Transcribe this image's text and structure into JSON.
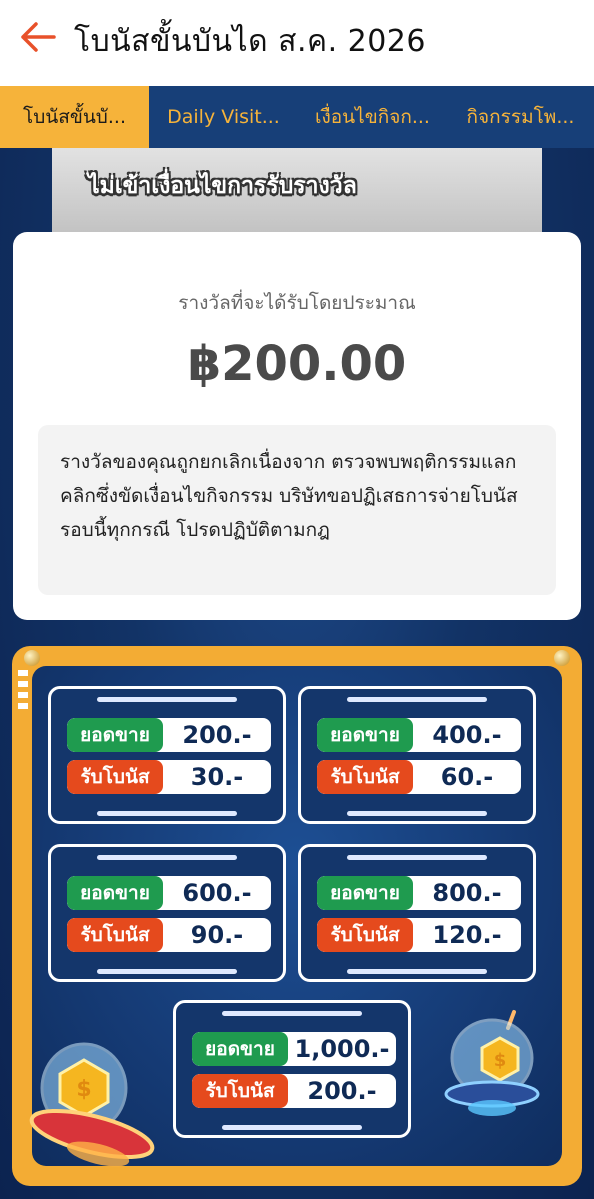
{
  "header": {
    "title": "โบนัสขั้นบันได ส.ค. 2026"
  },
  "tabs": [
    {
      "label": "โบนัสขั้นบั...",
      "active": true
    },
    {
      "label": "Daily Visit...",
      "active": false
    },
    {
      "label": "เงื่อนไขกิจก...",
      "active": false
    },
    {
      "label": "กิจกรรมโพ...",
      "active": false
    }
  ],
  "banner": {
    "text": "ไม่เข้าเงื่อนไขการรับรางวัล"
  },
  "card": {
    "label": "รางวัลที่จะได้รับโดยประมาณ",
    "amount": "฿200.00",
    "notice": "รางวัลของคุณถูกยกเลิกเนื่องจาก ตรวจพบพฤติกรรมแลกคลิกซึ่งขัดเงื่อนไขกิจกรรม บริษัทขอปฏิเสธการจ่ายโบนัสรอบนี้ทุกกรณี โปรดปฏิบัติตามกฎ"
  },
  "tiers": [
    {
      "sales_label": "ยอดขาย",
      "sales": "200.-",
      "bonus_label": "รับโบนัส",
      "bonus": "30.-"
    },
    {
      "sales_label": "ยอดขาย",
      "sales": "400.-",
      "bonus_label": "รับโบนัส",
      "bonus": "60.-"
    },
    {
      "sales_label": "ยอดขาย",
      "sales": "600.-",
      "bonus_label": "รับโบนัส",
      "bonus": "90.-"
    },
    {
      "sales_label": "ยอดขาย",
      "sales": "800.-",
      "bonus_label": "รับโบนัส",
      "bonus": "120.-"
    },
    {
      "sales_label": "ยอดขาย",
      "sales": "1,000.-",
      "bonus_label": "รับโบนัส",
      "bonus": "200.-"
    }
  ],
  "colors": {
    "accent": "#f6b33a",
    "tab_bg": "#173f78",
    "sales_green": "#1f9b4f",
    "bonus_red": "#e54a1d",
    "back_arrow": "#e8512a"
  },
  "icons": {
    "back": "arrow-left-icon",
    "coin": "coin-icon",
    "ufo": "ufo-icon"
  }
}
